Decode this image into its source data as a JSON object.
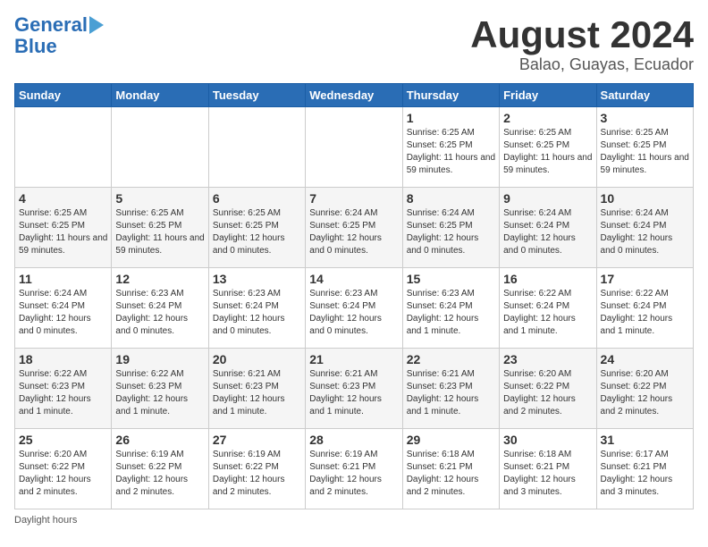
{
  "header": {
    "logo_line1": "General",
    "logo_line2": "Blue",
    "month": "August 2024",
    "location": "Balao, Guayas, Ecuador"
  },
  "days_of_week": [
    "Sunday",
    "Monday",
    "Tuesday",
    "Wednesday",
    "Thursday",
    "Friday",
    "Saturday"
  ],
  "weeks": [
    [
      {
        "num": "",
        "info": ""
      },
      {
        "num": "",
        "info": ""
      },
      {
        "num": "",
        "info": ""
      },
      {
        "num": "",
        "info": ""
      },
      {
        "num": "1",
        "info": "Sunrise: 6:25 AM\nSunset: 6:25 PM\nDaylight: 11 hours and 59 minutes."
      },
      {
        "num": "2",
        "info": "Sunrise: 6:25 AM\nSunset: 6:25 PM\nDaylight: 11 hours and 59 minutes."
      },
      {
        "num": "3",
        "info": "Sunrise: 6:25 AM\nSunset: 6:25 PM\nDaylight: 11 hours and 59 minutes."
      }
    ],
    [
      {
        "num": "4",
        "info": "Sunrise: 6:25 AM\nSunset: 6:25 PM\nDaylight: 11 hours and 59 minutes."
      },
      {
        "num": "5",
        "info": "Sunrise: 6:25 AM\nSunset: 6:25 PM\nDaylight: 11 hours and 59 minutes."
      },
      {
        "num": "6",
        "info": "Sunrise: 6:25 AM\nSunset: 6:25 PM\nDaylight: 12 hours and 0 minutes."
      },
      {
        "num": "7",
        "info": "Sunrise: 6:24 AM\nSunset: 6:25 PM\nDaylight: 12 hours and 0 minutes."
      },
      {
        "num": "8",
        "info": "Sunrise: 6:24 AM\nSunset: 6:25 PM\nDaylight: 12 hours and 0 minutes."
      },
      {
        "num": "9",
        "info": "Sunrise: 6:24 AM\nSunset: 6:24 PM\nDaylight: 12 hours and 0 minutes."
      },
      {
        "num": "10",
        "info": "Sunrise: 6:24 AM\nSunset: 6:24 PM\nDaylight: 12 hours and 0 minutes."
      }
    ],
    [
      {
        "num": "11",
        "info": "Sunrise: 6:24 AM\nSunset: 6:24 PM\nDaylight: 12 hours and 0 minutes."
      },
      {
        "num": "12",
        "info": "Sunrise: 6:23 AM\nSunset: 6:24 PM\nDaylight: 12 hours and 0 minutes."
      },
      {
        "num": "13",
        "info": "Sunrise: 6:23 AM\nSunset: 6:24 PM\nDaylight: 12 hours and 0 minutes."
      },
      {
        "num": "14",
        "info": "Sunrise: 6:23 AM\nSunset: 6:24 PM\nDaylight: 12 hours and 0 minutes."
      },
      {
        "num": "15",
        "info": "Sunrise: 6:23 AM\nSunset: 6:24 PM\nDaylight: 12 hours and 1 minute."
      },
      {
        "num": "16",
        "info": "Sunrise: 6:22 AM\nSunset: 6:24 PM\nDaylight: 12 hours and 1 minute."
      },
      {
        "num": "17",
        "info": "Sunrise: 6:22 AM\nSunset: 6:24 PM\nDaylight: 12 hours and 1 minute."
      }
    ],
    [
      {
        "num": "18",
        "info": "Sunrise: 6:22 AM\nSunset: 6:23 PM\nDaylight: 12 hours and 1 minute."
      },
      {
        "num": "19",
        "info": "Sunrise: 6:22 AM\nSunset: 6:23 PM\nDaylight: 12 hours and 1 minute."
      },
      {
        "num": "20",
        "info": "Sunrise: 6:21 AM\nSunset: 6:23 PM\nDaylight: 12 hours and 1 minute."
      },
      {
        "num": "21",
        "info": "Sunrise: 6:21 AM\nSunset: 6:23 PM\nDaylight: 12 hours and 1 minute."
      },
      {
        "num": "22",
        "info": "Sunrise: 6:21 AM\nSunset: 6:23 PM\nDaylight: 12 hours and 1 minute."
      },
      {
        "num": "23",
        "info": "Sunrise: 6:20 AM\nSunset: 6:22 PM\nDaylight: 12 hours and 2 minutes."
      },
      {
        "num": "24",
        "info": "Sunrise: 6:20 AM\nSunset: 6:22 PM\nDaylight: 12 hours and 2 minutes."
      }
    ],
    [
      {
        "num": "25",
        "info": "Sunrise: 6:20 AM\nSunset: 6:22 PM\nDaylight: 12 hours and 2 minutes."
      },
      {
        "num": "26",
        "info": "Sunrise: 6:19 AM\nSunset: 6:22 PM\nDaylight: 12 hours and 2 minutes."
      },
      {
        "num": "27",
        "info": "Sunrise: 6:19 AM\nSunset: 6:22 PM\nDaylight: 12 hours and 2 minutes."
      },
      {
        "num": "28",
        "info": "Sunrise: 6:19 AM\nSunset: 6:21 PM\nDaylight: 12 hours and 2 minutes."
      },
      {
        "num": "29",
        "info": "Sunrise: 6:18 AM\nSunset: 6:21 PM\nDaylight: 12 hours and 2 minutes."
      },
      {
        "num": "30",
        "info": "Sunrise: 6:18 AM\nSunset: 6:21 PM\nDaylight: 12 hours and 3 minutes."
      },
      {
        "num": "31",
        "info": "Sunrise: 6:17 AM\nSunset: 6:21 PM\nDaylight: 12 hours and 3 minutes."
      }
    ]
  ],
  "footer": "Daylight hours"
}
